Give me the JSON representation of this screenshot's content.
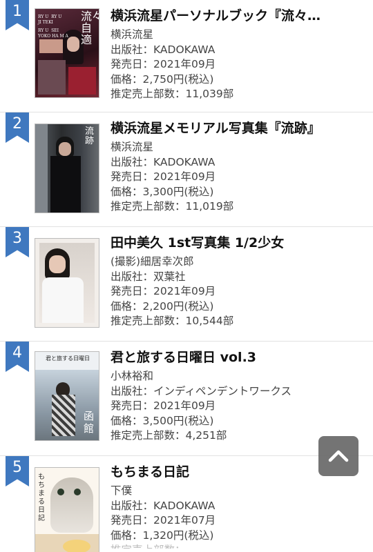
{
  "labels": {
    "publisher": "出版社：",
    "release": "発売日：",
    "price": "価格：",
    "sales": "推定売上部数："
  },
  "books": [
    {
      "rank": "1",
      "title": "横浜流星パーソナルブック『流々…",
      "author": "横浜流星",
      "publisher": "KADOKAWA",
      "release": "2021年09月",
      "price": "2,750円(税込)",
      "sales": "11,039部",
      "cover_text": [
        "流々自適",
        "RY U  RY U\nJI TEKI",
        "RY U  SEI\nYOKO HA M A"
      ]
    },
    {
      "rank": "2",
      "title": "横浜流星メモリアル写真集『流跡』",
      "author": "横浜流星",
      "publisher": "KADOKAWA",
      "release": "2021年09月",
      "price": "3,300円(税込)",
      "sales": "11,019部",
      "cover_text": [
        "流跡"
      ]
    },
    {
      "rank": "3",
      "title": "田中美久 1st写真集 1/2少女",
      "author": "(撮影)細居幸次郎",
      "publisher": "双葉社",
      "release": "2021年09月",
      "price": "2,200円(税込)",
      "sales": "10,544部",
      "cover_text": []
    },
    {
      "rank": "4",
      "title": "君と旅する日曜日 vol.3",
      "author": "小林裕和",
      "publisher": "インディペンデントワークス",
      "release": "2021年09月",
      "price": "3,500円(税込)",
      "sales": "4,251部",
      "cover_text": [
        "君と旅する日曜日",
        "函館"
      ]
    },
    {
      "rank": "5",
      "title": "もちまる日記",
      "author": "下僕",
      "publisher": "KADOKAWA",
      "release": "2021年07月",
      "price": "1,320円(税込)",
      "sales": "",
      "cover_text": [
        "もちまる日記"
      ]
    }
  ],
  "scroll_top": {
    "icon": "chevron-up-icon"
  },
  "colors": {
    "rank_badge": "#3f78bf",
    "scroll_top_bg": "#6d6d6d"
  }
}
